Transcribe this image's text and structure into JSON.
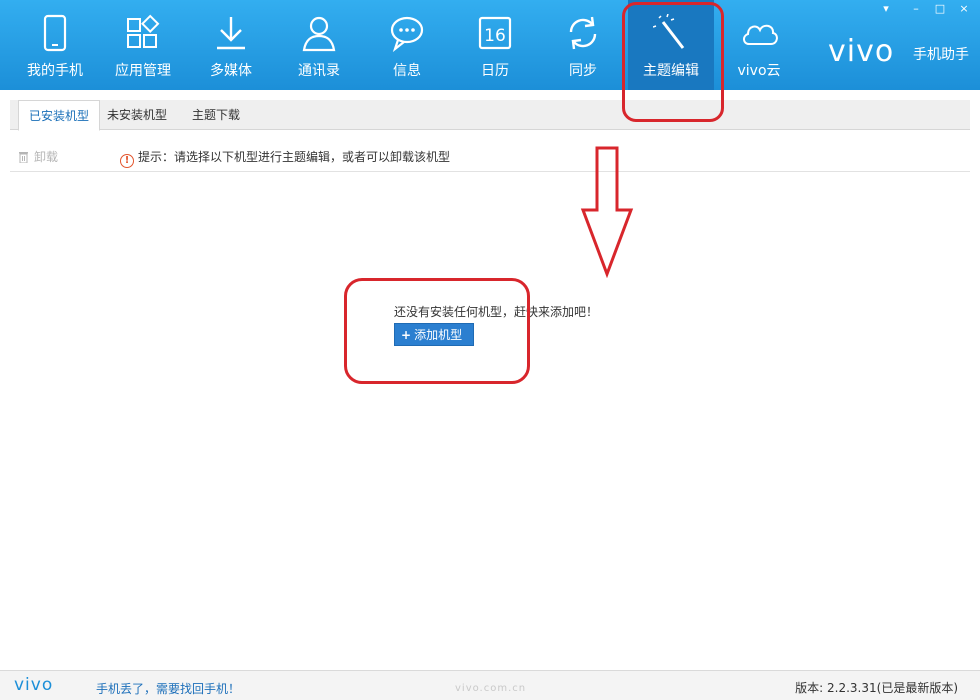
{
  "header": {
    "nav": [
      {
        "label": "我的手机",
        "icon": "phone-icon"
      },
      {
        "label": "应用管理",
        "icon": "apps-icon"
      },
      {
        "label": "多媒体",
        "icon": "download-icon"
      },
      {
        "label": "通讯录",
        "icon": "contact-icon"
      },
      {
        "label": "信息",
        "icon": "message-icon"
      },
      {
        "label": "日历",
        "icon": "calendar-icon",
        "day": "16"
      },
      {
        "label": "同步",
        "icon": "sync-icon"
      },
      {
        "label": "主题编辑",
        "icon": "magic-wand-icon"
      },
      {
        "label": "vivo云",
        "icon": "cloud-icon"
      }
    ],
    "brand": {
      "logo": "vivo",
      "text": "手机助手"
    },
    "window_controls": {
      "menu": "▾",
      "minimize": "–",
      "maximize": "□",
      "close": "×"
    }
  },
  "tabs": [
    {
      "label": "已安装机型"
    },
    {
      "label": "未安装机型"
    },
    {
      "label": "主题下载"
    }
  ],
  "toolbar": {
    "uninstall_label": "卸载",
    "hint_icon": "!",
    "hint_text": "提示：请选择以下机型进行主题编辑，或者可以卸载该机型"
  },
  "empty_state": {
    "message": "还没有安装任何机型，赶快来添加吧！",
    "add_button_label": "添加机型"
  },
  "footer": {
    "logo": "vivo",
    "lost_phone_link": "手机丢了，需要找回手机！",
    "watermark": "vivo.com.cn",
    "version": "版本: 2.2.3.31(已是最新版本)"
  },
  "colors": {
    "header_top": "#33aef0",
    "header_bottom": "#1c8fd8",
    "active_nav": "#1978c0",
    "annotation": "#d8262c",
    "button": "#2b7fd0"
  }
}
